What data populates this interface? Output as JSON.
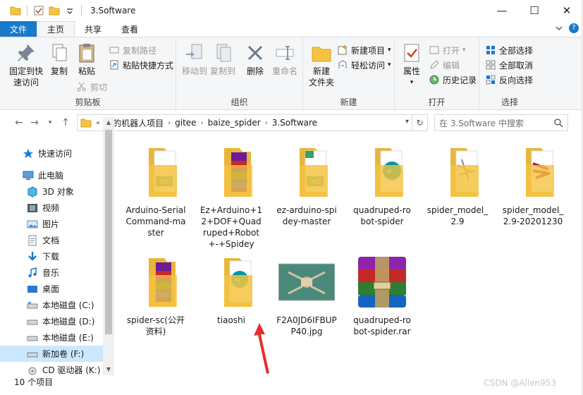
{
  "window": {
    "title": "3.Software",
    "controls": {
      "minimize": "—",
      "maximize": "☐",
      "close": "✕"
    }
  },
  "ribbon_tabs": [
    "文件",
    "主页",
    "共享",
    "查看"
  ],
  "ribbon": {
    "clipboard": {
      "label": "剪贴板",
      "pin": "固定到快\n速访问",
      "copy": "复制",
      "paste": "粘贴",
      "copy_path": "复制路径",
      "paste_shortcut": "粘贴快捷方式",
      "cut": "剪切"
    },
    "organize": {
      "label": "组织",
      "move_to": "移动到",
      "copy_to": "复制到",
      "delete": "删除",
      "rename": "重命名"
    },
    "new": {
      "label": "新建",
      "new_folder": "新建\n文件夹",
      "new_item": "新建项目",
      "easy_access": "轻松访问"
    },
    "open": {
      "label": "打开",
      "properties": "属性",
      "open": "打开",
      "edit": "编辑",
      "history": "历史记录"
    },
    "select": {
      "label": "选择",
      "select_all": "全部选择",
      "select_none": "全部取消",
      "invert": "反向选择"
    }
  },
  "address": {
    "prefix": "«",
    "crumbs": [
      "我的机器人项目",
      "gitee",
      "baize_spider",
      "3.Software"
    ]
  },
  "search": {
    "placeholder": "在 3.Software 中搜索"
  },
  "nav_pane": [
    {
      "label": "快速访问",
      "icon": "star-icon"
    },
    {
      "label": "此电脑",
      "icon": "computer-icon"
    },
    {
      "label": "3D 对象",
      "icon": "cube-icon"
    },
    {
      "label": "视频",
      "icon": "video-icon"
    },
    {
      "label": "图片",
      "icon": "picture-icon"
    },
    {
      "label": "文档",
      "icon": "document-icon"
    },
    {
      "label": "下载",
      "icon": "download-icon"
    },
    {
      "label": "音乐",
      "icon": "music-icon"
    },
    {
      "label": "桌面",
      "icon": "desktop-icon"
    },
    {
      "label": "本地磁盘 (C:)",
      "icon": "drive-icon"
    },
    {
      "label": "本地磁盘 (D:)",
      "icon": "drive-icon"
    },
    {
      "label": "本地磁盘 (E:)",
      "icon": "drive-icon"
    },
    {
      "label": "新加卷 (F:)",
      "icon": "drive-icon"
    },
    {
      "label": "CD 驱动器 (K:)",
      "icon": "cd-icon"
    }
  ],
  "items": [
    {
      "name": "Arduino-Serial\nCommand-ma\nster",
      "type": "folder-md"
    },
    {
      "name": "Ez+Arduino+1\n2+DOF+Quad\nruped+Robot\n+-+Spidey",
      "type": "folder-rar"
    },
    {
      "name": "ez-arduino-spi\ndey-master",
      "type": "folder-md-green"
    },
    {
      "name": "quadruped-ro\nbot-spider",
      "type": "folder-arduino"
    },
    {
      "name": "spider_model_\n2.9",
      "type": "folder-model"
    },
    {
      "name": "spider_model_\n2.9-20201230",
      "type": "folder-model-red"
    },
    {
      "name": "spider-sc(公开\n资料)",
      "type": "folder-rar"
    },
    {
      "name": "tiaoshi",
      "type": "folder-arduino-plain"
    },
    {
      "name": "F2A0JD6IFBUP\nP40.jpg",
      "type": "image"
    },
    {
      "name": "quadruped-ro\nbot-spider.rar",
      "type": "rar"
    }
  ],
  "status": {
    "count": "10 个项目"
  },
  "watermark": "CSDN @Allen953",
  "colors": {
    "accent": "#1979ca",
    "folder": "#f5c342",
    "selection": "#cce8ff",
    "annotation_arrow": "#e53030"
  }
}
